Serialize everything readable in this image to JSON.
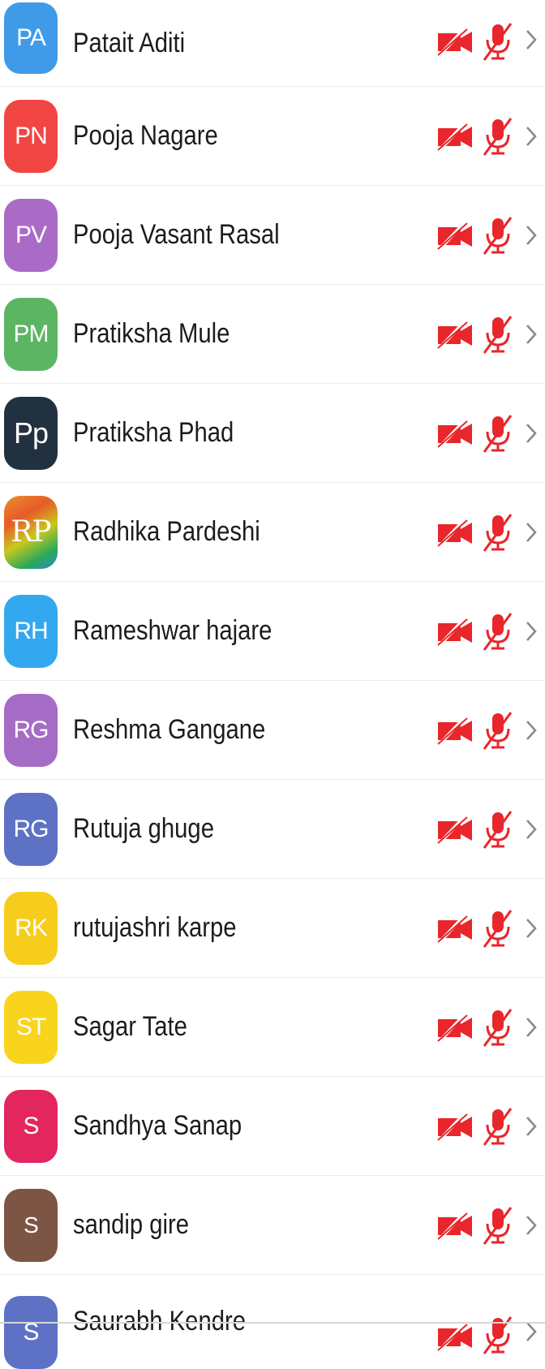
{
  "participants": [
    {
      "initials": "PA",
      "name": "Patait Aditi",
      "color": "#3f9be8"
    },
    {
      "initials": "PN",
      "name": "Pooja Nagare",
      "color": "#f04543"
    },
    {
      "initials": "PV",
      "name": "Pooja Vasant Rasal",
      "color": "#a96bc6"
    },
    {
      "initials": "PM",
      "name": "Pratiksha Mule",
      "color": "#5cb563"
    },
    {
      "initials": "Pp",
      "name": "Pratiksha Phad",
      "color": "#22313f"
    },
    {
      "initials": "RP",
      "name": "Radhika Pardeshi",
      "color": "#e8902a"
    },
    {
      "initials": "RH",
      "name": "Rameshwar hajare",
      "color": "#34a8ee"
    },
    {
      "initials": "RG",
      "name": "Reshma Gangane",
      "color": "#a56cc5"
    },
    {
      "initials": "RG",
      "name": "Rutuja ghuge",
      "color": "#5d72c4"
    },
    {
      "initials": "RK",
      "name": "rutujashri karpe",
      "color": "#f7cd1d"
    },
    {
      "initials": "ST",
      "name": "Sagar Tate",
      "color": "#f8d41c"
    },
    {
      "initials": "S",
      "name": "Sandhya Sanap",
      "color": "#e3265e"
    },
    {
      "initials": "S",
      "name": "sandip gire",
      "color": "#7c5545"
    },
    {
      "initials": "S",
      "name": "Saurabh Kendre",
      "color": "#5d72c4"
    }
  ],
  "icons": {
    "camera": "video-off-icon",
    "mic": "mic-off-icon",
    "chevron": "chevron-right-icon",
    "alert_color": "#e8262b",
    "chevron_color": "#888888"
  }
}
